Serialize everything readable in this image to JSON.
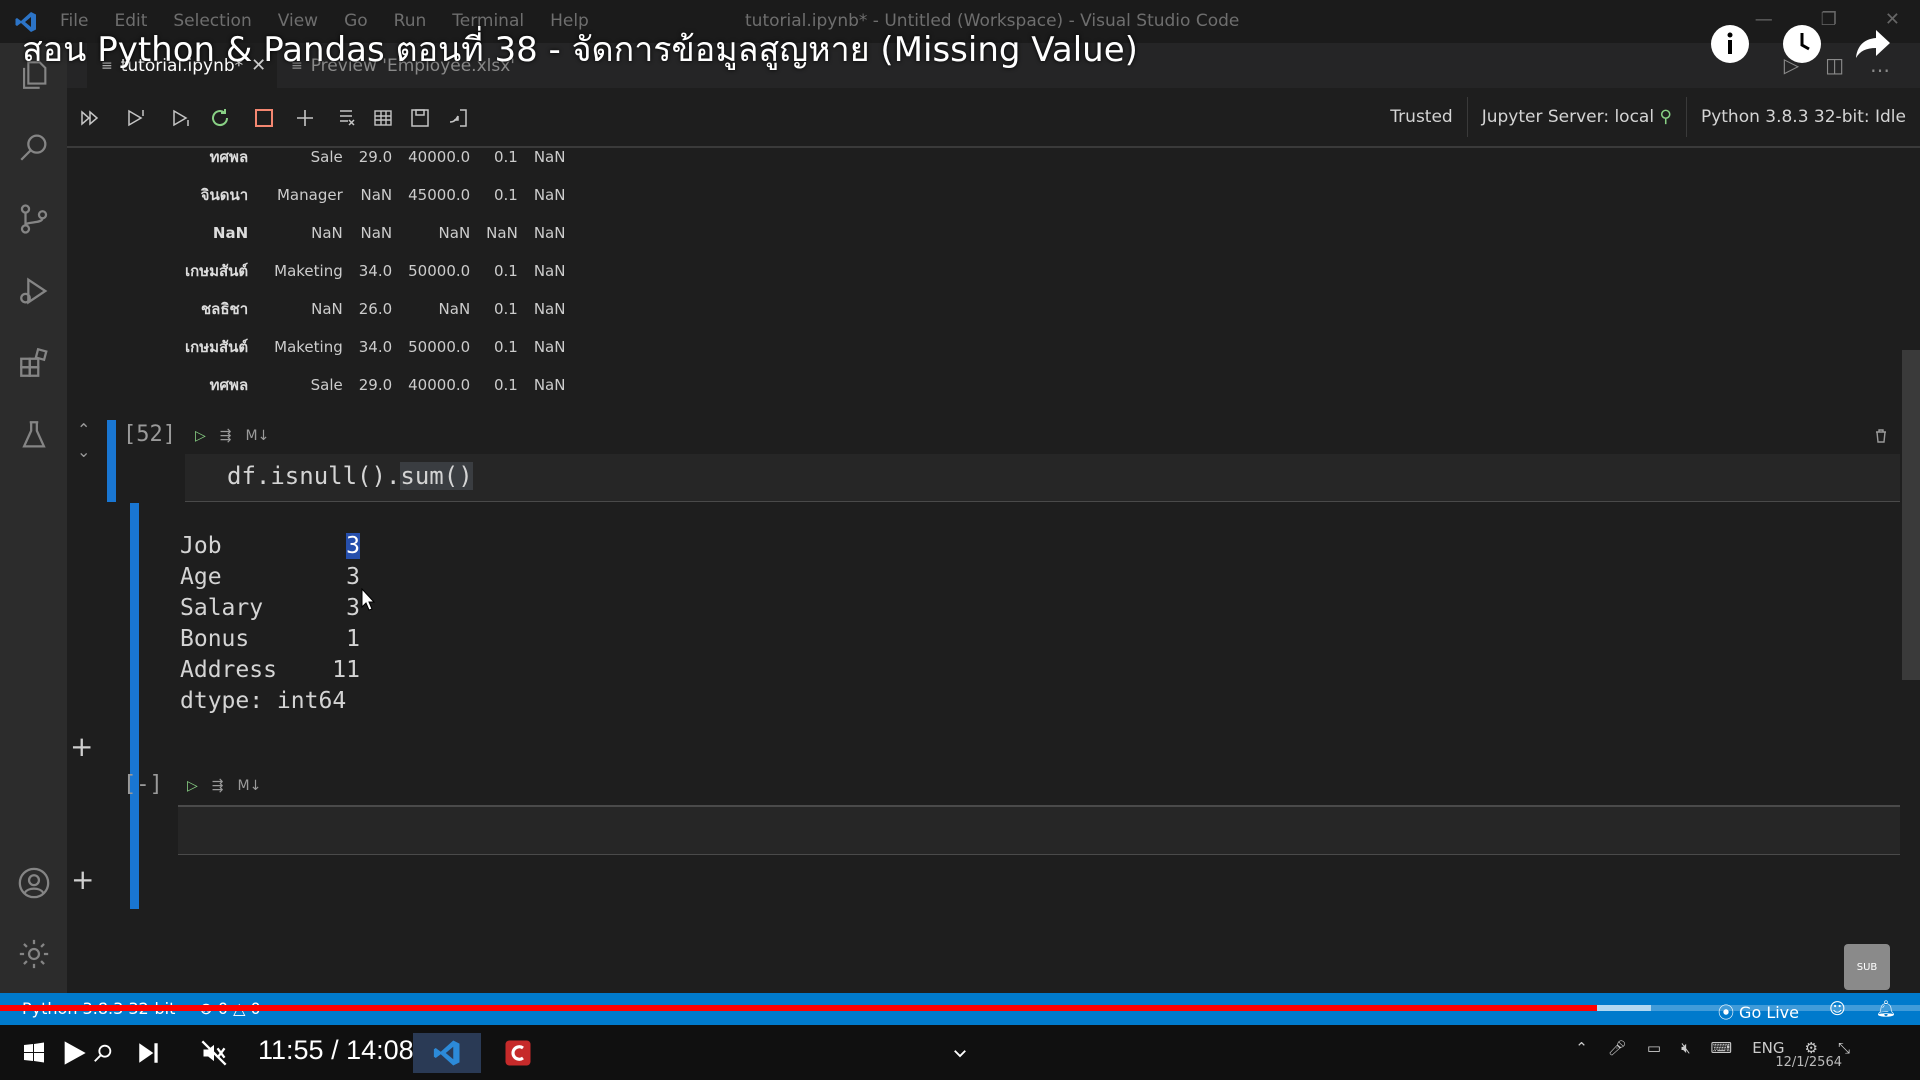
{
  "window": {
    "menu": [
      "File",
      "Edit",
      "Selection",
      "View",
      "Go",
      "Run",
      "Terminal",
      "Help"
    ],
    "title": "tutorial.ipynb* - Untitled (Workspace) - Visual Studio Code"
  },
  "video": {
    "title": "สอน Python & Pandas ตอนที่ 38 - จัดการข้อมูลสูญหาย (Missing Value)",
    "time": "11:55 / 14:08",
    "progress_fraction": 0.832,
    "buffered_fraction": 0.86
  },
  "tabs": [
    {
      "label": "tutorial.ipynb*",
      "close": "✕"
    },
    {
      "label": "Preview 'Employee.xlsx'"
    }
  ],
  "toolbar": {
    "trusted": "Trusted",
    "server": "Jupyter Server: local",
    "kernel": "Python 3.8.3 32-bit: Idle"
  },
  "dataframe": {
    "rows": [
      [
        "ทศพล",
        "Sale",
        "29.0",
        "40000.0",
        "0.1",
        "NaN"
      ],
      [
        "จินดนา",
        "Manager",
        "NaN",
        "45000.0",
        "0.1",
        "NaN"
      ],
      [
        "NaN",
        "NaN",
        "NaN",
        "NaN",
        "NaN",
        "NaN"
      ],
      [
        "เกษมสันต์",
        "Maketing",
        "34.0",
        "50000.0",
        "0.1",
        "NaN"
      ],
      [
        "ชลธิชา",
        "NaN",
        "26.0",
        "NaN",
        "0.1",
        "NaN"
      ],
      [
        "เกษมสันต์",
        "Maketing",
        "34.0",
        "50000.0",
        "0.1",
        "NaN"
      ],
      [
        "ทศพล",
        "Sale",
        "29.0",
        "40000.0",
        "0.1",
        "NaN"
      ]
    ]
  },
  "cell52": {
    "exec_count": "[52]",
    "md_label": "M↓",
    "code_prefix": "df.isnull().",
    "code_highlight": "sum()",
    "output": [
      {
        "key": "Job",
        "value": "3"
      },
      {
        "key": "Age",
        "value": "3"
      },
      {
        "key": "Salary",
        "value": "3"
      },
      {
        "key": "Bonus",
        "value": "1"
      },
      {
        "key": "Address",
        "value": "11"
      }
    ],
    "dtype": "dtype: int64"
  },
  "cell_empty": {
    "exec_count": "[-]",
    "md_label": "M↓"
  },
  "statusbar": {
    "interpreter": "Python 3.8.3 32-bit",
    "problems": "⊗ 0 △ 0",
    "go_live": "Go Live"
  },
  "taskbar": {
    "lang": "ENG",
    "date": "12/1/2564",
    "sub_label": "SUB"
  },
  "colors": {
    "accent": "#007acc",
    "cell_bar": "#1976d2",
    "progress": "#ff0000"
  }
}
